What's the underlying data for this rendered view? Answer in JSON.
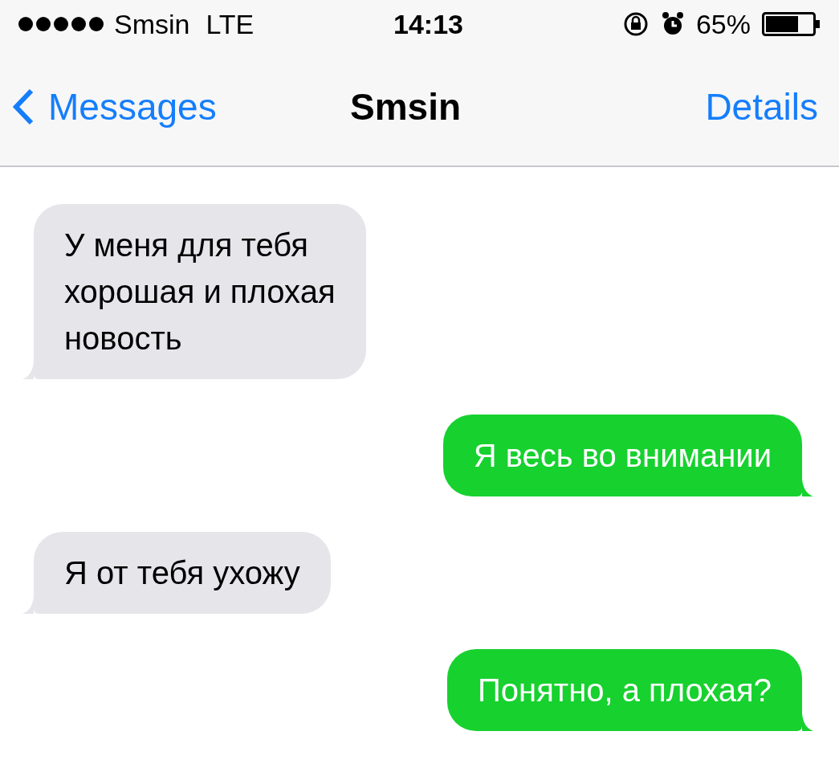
{
  "status_bar": {
    "carrier": "Smsin",
    "network": "LTE",
    "time": "14:13",
    "battery": "65%"
  },
  "nav_bar": {
    "back": "Messages",
    "title": "Smsin",
    "action": "Details"
  },
  "messages": [
    {
      "kind": "incoming",
      "lines": [
        "У меня для тебя",
        "хорошая и плохая",
        "новость"
      ]
    },
    {
      "kind": "outgoing",
      "lines": [
        "Я весь во внимании"
      ]
    },
    {
      "kind": "incoming",
      "lines": [
        "Я от тебя ухожу"
      ]
    },
    {
      "kind": "outgoing",
      "lines": [
        "Понятно, а плохая?"
      ]
    }
  ]
}
